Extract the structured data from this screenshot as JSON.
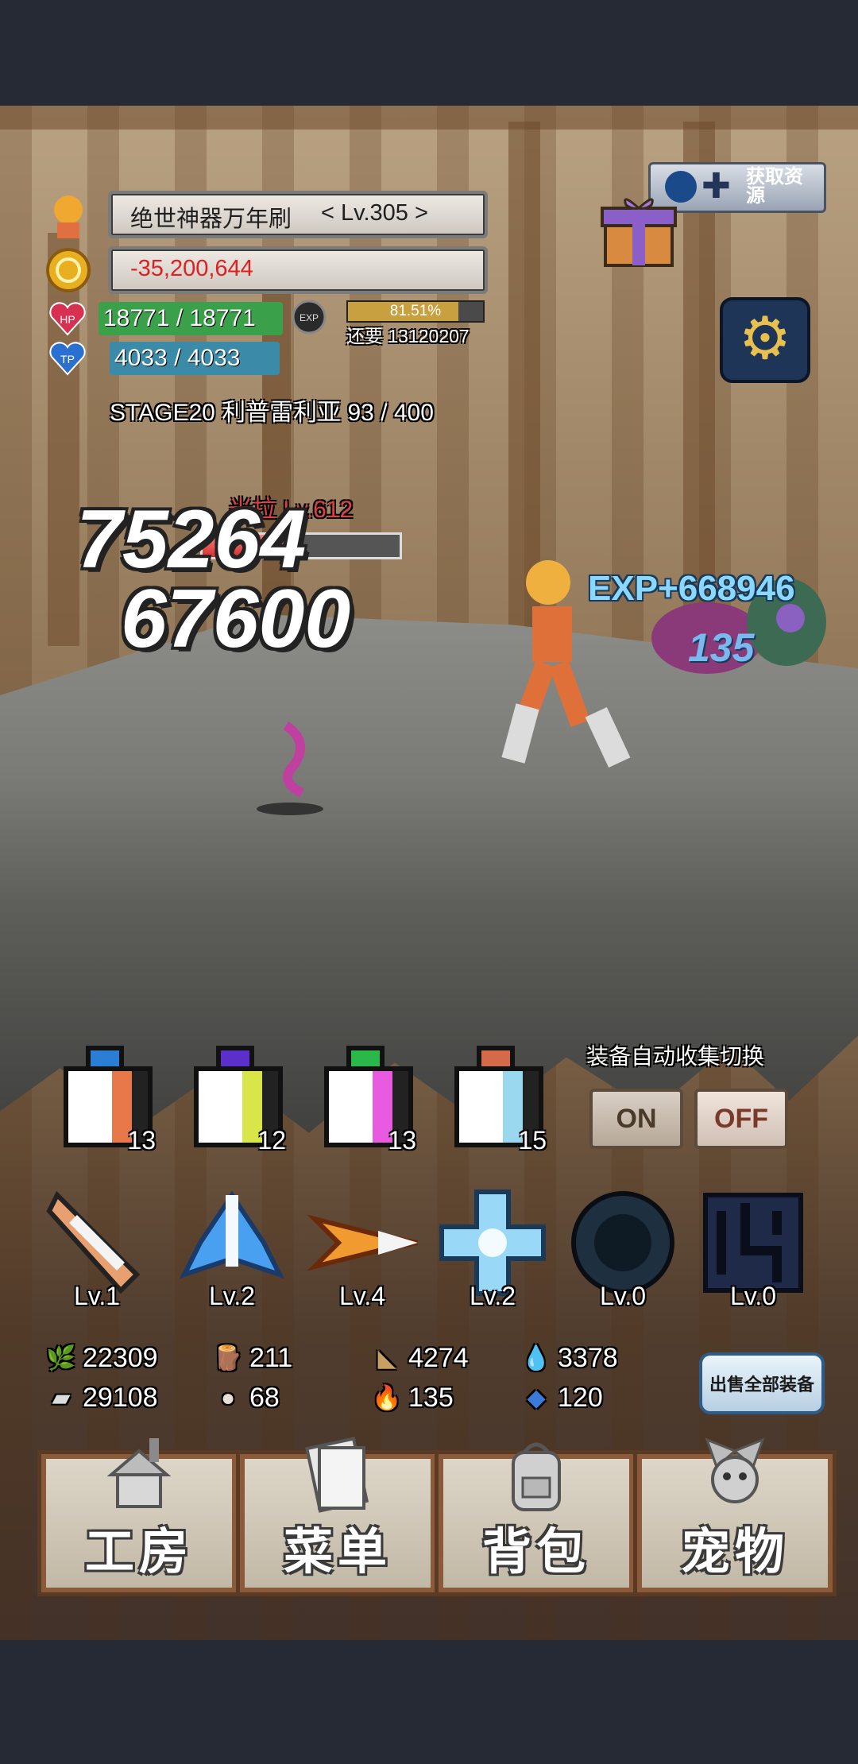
{
  "header": {
    "title_text": "绝世神器万年刷",
    "level_text": "< Lv.305 >",
    "gold": "-35,200,644",
    "hp": "18771 / 18771",
    "tp": "4033 / 4033",
    "exp_percent": "81.51%",
    "exp_progress": 0.8151,
    "exp_remaining": "还要 13120207",
    "hp_badge": "HP",
    "tp_badge": "TP",
    "exp_badge": "EXP",
    "stage": "STAGE20 利普雷利亚 93 / 400"
  },
  "top_right": {
    "bonus_label": "获取资源"
  },
  "battle": {
    "enemy_name": "米拉 Lv.612",
    "enemy_hp_progress": 0.48,
    "damage_1": "75264",
    "damage_2": "67600",
    "exp_gain": "EXP+668946",
    "enemy_damage": "135"
  },
  "potions": [
    {
      "count": "13",
      "cap": "#2a7fd4",
      "tint": "#e8784a",
      "icon": "potion-blue-icon"
    },
    {
      "count": "12",
      "cap": "#5b2fc9",
      "tint": "#d8e64a",
      "icon": "potion-purple-icon"
    },
    {
      "count": "13",
      "cap": "#2ab84a",
      "tint": "#e85ae0",
      "icon": "potion-green-icon"
    },
    {
      "count": "15",
      "cap": "#d46a4a",
      "tint": "#9ad8ef",
      "icon": "potion-orange-icon"
    }
  ],
  "auto_collect": {
    "label": "装备自动收集切换",
    "on": "ON",
    "off": "OFF"
  },
  "skills": [
    {
      "level": "Lv.1",
      "color": "#e8a070",
      "icon": "feather-blade-icon"
    },
    {
      "level": "Lv.2",
      "color": "#4aa0f0",
      "icon": "ice-sword-icon"
    },
    {
      "level": "Lv.4",
      "color": "#f09a30",
      "icon": "fire-arrow-icon"
    },
    {
      "level": "Lv.2",
      "color": "#9ad8f8",
      "icon": "holy-cross-icon"
    },
    {
      "level": "Lv.0",
      "color": "#1e3040",
      "icon": "dark-orb-icon"
    },
    {
      "level": "Lv.0",
      "color": "#1e2a48",
      "icon": "shadow-glyph-icon"
    }
  ],
  "resources": [
    {
      "value": "22309",
      "icon": "herb-icon",
      "glyph": "🌿"
    },
    {
      "value": "211",
      "icon": "wood-icon",
      "glyph": "🪵"
    },
    {
      "value": "4274",
      "icon": "plank-icon",
      "glyph": "◣"
    },
    {
      "value": "3378",
      "icon": "water-drop-icon",
      "glyph": "💧"
    },
    {
      "value": "29108",
      "icon": "iron-ingot-icon",
      "glyph": "▰"
    },
    {
      "value": "68",
      "icon": "stone-icon",
      "glyph": "●"
    },
    {
      "value": "135",
      "icon": "blue-flame-icon",
      "glyph": "🔥"
    },
    {
      "value": "120",
      "icon": "blue-gem-icon",
      "glyph": "◆"
    }
  ],
  "sell_all": "出售全部装备",
  "nav": [
    {
      "label": "工房",
      "icon": "workshop-icon"
    },
    {
      "label": "菜单",
      "icon": "menu-book-icon"
    },
    {
      "label": "背包",
      "icon": "backpack-icon"
    },
    {
      "label": "宠物",
      "icon": "pet-dragon-icon"
    }
  ],
  "colors": {
    "hp_bar": "#3aa04a",
    "tp_bar": "#3a8aa8",
    "gold_text": "#e02020",
    "exp_text": "#8ad8ff"
  }
}
